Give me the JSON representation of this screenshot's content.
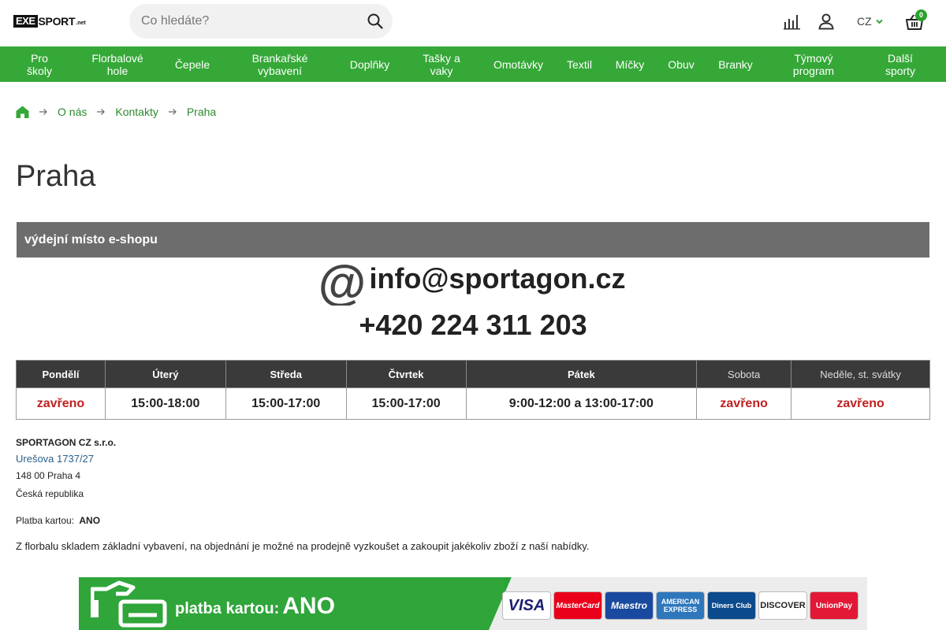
{
  "header": {
    "logo_box": "EXE",
    "logo_word": "SPORT",
    "logo_suffix": ".net",
    "search_placeholder": "Co hledáte?",
    "language": "CZ",
    "basket_count": "0"
  },
  "nav": {
    "items": [
      {
        "label": "Pro\nškoly"
      },
      {
        "label": "Florbalové\nhole"
      },
      {
        "label": "Čepele"
      },
      {
        "label": "Brankařské\nvybavení"
      },
      {
        "label": "Doplňky"
      },
      {
        "label": "Tašky a\nvaky"
      },
      {
        "label": "Omotávky"
      },
      {
        "label": "Textil"
      },
      {
        "label": "Míčky"
      },
      {
        "label": "Obuv"
      },
      {
        "label": "Branky"
      },
      {
        "label": "Týmový\nprogram"
      },
      {
        "label": "Další\nsporty"
      }
    ]
  },
  "breadcrumb": {
    "items": [
      "O nás",
      "Kontakty",
      "Praha"
    ]
  },
  "page": {
    "title": "Praha",
    "pickup_label": "výdejní místo e-shopu",
    "email": "info@sportagon.cz",
    "phone": "+420 224 311 203"
  },
  "hours": {
    "headers": [
      "Pondělí",
      "Úterý",
      "Středa",
      "Čtvrtek",
      "Pátek",
      "Sobota",
      "Neděle, st. svátky"
    ],
    "values": [
      "zavřeno",
      "15:00-18:00",
      "15:00-17:00",
      "15:00-17:00",
      "9:00-12:00 a 13:00-17:00",
      "zavřeno",
      "zavřeno"
    ]
  },
  "company": {
    "name": "SPORTAGON CZ s.r.o.",
    "street": "Urešova 1737/27",
    "city": "148 00  Praha 4",
    "country": "Česká republika",
    "payment_label": "Platba kartou:",
    "payment_value": "ANO",
    "note": "Z florbalu skladem základní vybavení, na objednání je možné na prodejně vyzkoušet a zakoupit jakékoliv zboží z naší nabídky."
  },
  "banner": {
    "text": "platba kartou:",
    "ano": "ANO",
    "cards": [
      "VISA",
      "MasterCard",
      "Maestro",
      "AMERICAN EXPRESS",
      "Diners Club",
      "DISCOVER",
      "UnionPay"
    ]
  },
  "colors": {
    "accent_green": "#35a837",
    "closed_red": "#c02020",
    "header_dark": "#3a3a3a"
  }
}
